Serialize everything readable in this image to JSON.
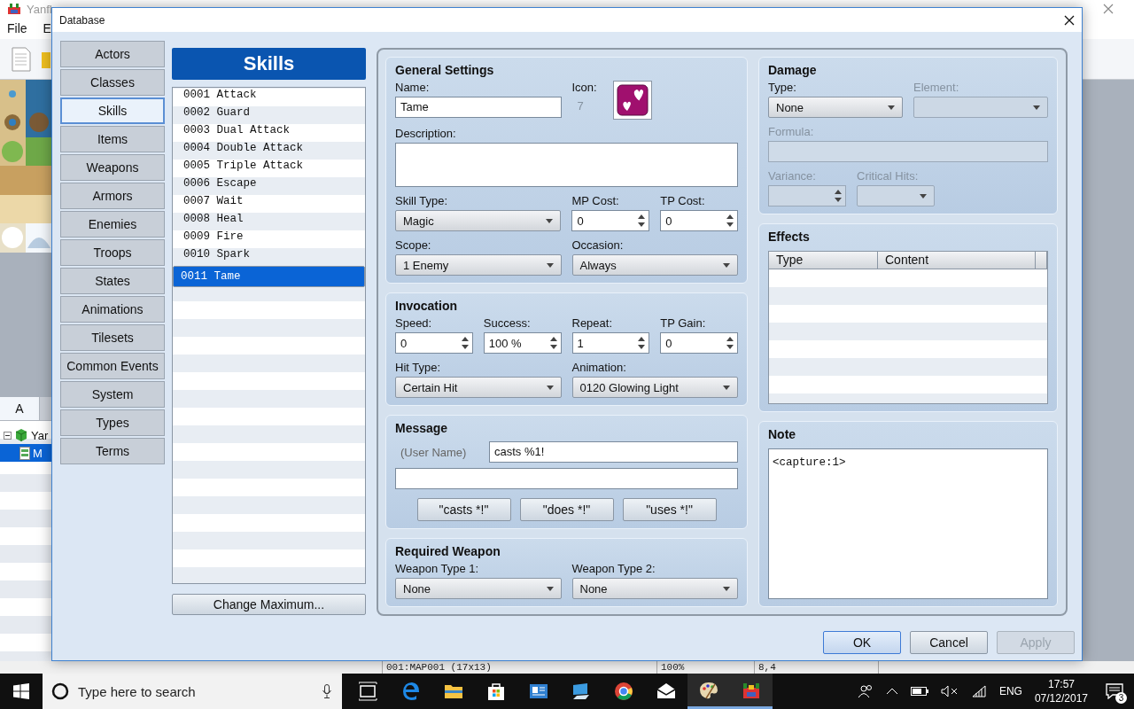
{
  "app": {
    "title": "Yanfl",
    "menu": [
      "File",
      "E"
    ],
    "tabs": [
      {
        "label": "A",
        "selected": true
      }
    ],
    "tree": [
      {
        "label": "Yar",
        "expanded": true,
        "selected": false,
        "children": [
          {
            "label": "M",
            "selected": true
          }
        ]
      }
    ],
    "status_bar": [
      "001:MAP001 (17x13)",
      "100%",
      "8,4"
    ]
  },
  "dialog": {
    "title": "Database",
    "categories": [
      {
        "label": "Actors",
        "selected": false
      },
      {
        "label": "Classes",
        "selected": false
      },
      {
        "label": "Skills",
        "selected": true
      },
      {
        "label": "Items",
        "selected": false
      },
      {
        "label": "Weapons",
        "selected": false
      },
      {
        "label": "Armors",
        "selected": false
      },
      {
        "label": "Enemies",
        "selected": false
      },
      {
        "label": "Troops",
        "selected": false
      },
      {
        "label": "States",
        "selected": false
      },
      {
        "label": "Animations",
        "selected": false
      },
      {
        "label": "Tilesets",
        "selected": false
      },
      {
        "label": "Common Events",
        "selected": false
      },
      {
        "label": "System",
        "selected": false
      },
      {
        "label": "Types",
        "selected": false
      },
      {
        "label": "Terms",
        "selected": false
      }
    ],
    "list": {
      "header": "Skills",
      "items": [
        {
          "label": "0001 Attack",
          "selected": false
        },
        {
          "label": "0002 Guard",
          "selected": false
        },
        {
          "label": "0003 Dual Attack",
          "selected": false
        },
        {
          "label": "0004 Double Attack",
          "selected": false
        },
        {
          "label": "0005 Triple Attack",
          "selected": false
        },
        {
          "label": "0006 Escape",
          "selected": false
        },
        {
          "label": "0007 Wait",
          "selected": false
        },
        {
          "label": "0008 Heal",
          "selected": false
        },
        {
          "label": "0009 Fire",
          "selected": false
        },
        {
          "label": "0010 Spark",
          "selected": false
        },
        {
          "label": "0011 Tame",
          "selected": true
        }
      ],
      "button": "Change Maximum..."
    },
    "left_groups": [
      {
        "kind": "form",
        "title": "General Settings",
        "rows": [
          [
            {
              "kind": "text",
              "label": "Name:",
              "value": "Tame",
              "disabled": false
            },
            {
              "kind": "icon",
              "label": "Icon:",
              "value": "7",
              "disabled": false
            }
          ],
          [
            {
              "kind": "textarea",
              "label": "Description:",
              "disabled": false
            }
          ],
          [
            {
              "kind": "select",
              "label": "Skill Type:",
              "value": "Magic",
              "disabled": false
            },
            {
              "kind": "spin",
              "label": "MP Cost:",
              "value": "0",
              "disabled": false
            },
            {
              "kind": "spin",
              "label": "TP Cost:",
              "value": "0",
              "disabled": false
            }
          ],
          [
            {
              "kind": "select",
              "label": "Scope:",
              "value": "1 Enemy",
              "disabled": false
            },
            {
              "kind": "select",
              "label": "Occasion:",
              "value": "Always",
              "disabled": false
            }
          ]
        ]
      },
      {
        "kind": "form",
        "title": "Invocation",
        "sections": [
          {
            "rows": [
              [
                {
                  "kind": "spin",
                  "label": "Speed:",
                  "value": "0",
                  "disabled": false
                },
                {
                  "kind": "spin",
                  "label": "Success:",
                  "value": "100 %",
                  "disabled": false
                },
                {
                  "kind": "spin",
                  "label": "Repeat:",
                  "value": "1",
                  "disabled": false
                },
                {
                  "kind": "spin",
                  "label": "TP Gain:",
                  "value": "0",
                  "disabled": false
                }
              ]
            ]
          },
          {
            "rows": [
              [
                {
                  "kind": "select",
                  "label": "Hit Type:",
                  "value": "Certain Hit",
                  "disabled": false
                },
                {
                  "kind": "select",
                  "label": "Animation:",
                  "value": "0120 Glowing Light",
                  "disabled": false
                }
              ]
            ]
          }
        ]
      },
      {
        "kind": "message",
        "title": "Message",
        "user_label": "(User Name)",
        "line1": "casts %1!",
        "buttons": [
          "\"casts *!\"",
          "\"does *!\"",
          "\"uses *!\""
        ]
      },
      {
        "kind": "form",
        "title": "Required Weapon",
        "rows": [
          [
            {
              "kind": "select",
              "label": "Weapon Type 1:",
              "value": "None",
              "disabled": false
            },
            {
              "kind": "select",
              "label": "Weapon Type 2:",
              "value": "None",
              "disabled": false
            }
          ]
        ]
      }
    ],
    "right_groups": [
      {
        "kind": "form",
        "title": "Damage",
        "rows": [
          [
            {
              "kind": "select",
              "label": "Type:",
              "value": "None",
              "disabled": false
            },
            {
              "kind": "select",
              "label": "Element:",
              "disabled": true
            }
          ],
          [
            {
              "kind": "text",
              "label": "Formula:",
              "disabled": true
            }
          ],
          [
            {
              "kind": "spin",
              "label": "Variance:",
              "disabled": true
            },
            {
              "kind": "select",
              "label": "Critical Hits:",
              "disabled": true
            }
          ]
        ]
      },
      {
        "kind": "table",
        "title": "Effects",
        "columns": [
          "Type",
          "Content"
        ]
      },
      {
        "kind": "note",
        "title": "Note",
        "value": "<capture:1>"
      }
    ],
    "buttons": [
      {
        "label": "OK",
        "disabled": false,
        "default": true
      },
      {
        "label": "Cancel",
        "disabled": false,
        "default": false
      },
      {
        "label": "Apply",
        "disabled": true,
        "default": false
      }
    ]
  },
  "taskbar": {
    "search": {
      "placeholder": "Type here to search"
    },
    "apps": [
      {
        "active": false
      },
      {
        "active": false
      },
      {
        "active": false
      },
      {
        "active": false
      },
      {
        "active": false
      },
      {
        "active": false
      },
      {
        "active": false
      },
      {
        "active": false
      },
      {
        "active": true
      },
      {
        "active": true
      }
    ],
    "language": "ENG",
    "time": "17:57",
    "date": "07/12/2017",
    "notifications": "3"
  }
}
